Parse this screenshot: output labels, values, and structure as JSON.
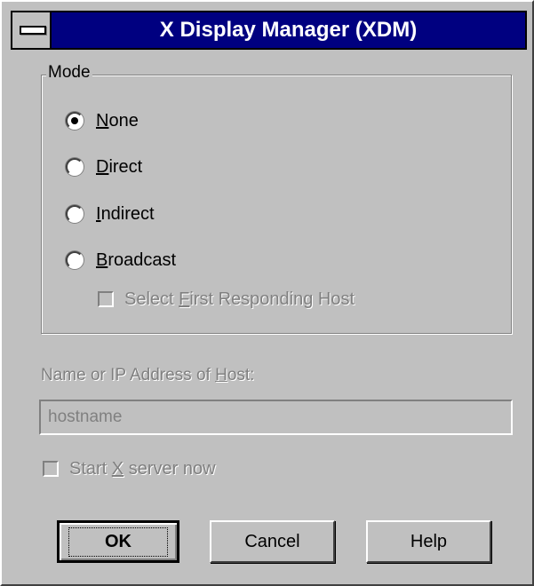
{
  "window": {
    "title": "X Display Manager (XDM)"
  },
  "mode_group": {
    "legend": "Mode",
    "options": [
      {
        "label_pre": "",
        "label_mnemonic": "N",
        "label_post": "one",
        "checked": true
      },
      {
        "label_pre": "",
        "label_mnemonic": "D",
        "label_post": "irect",
        "checked": false
      },
      {
        "label_pre": "",
        "label_mnemonic": "I",
        "label_post": "ndirect",
        "checked": false
      },
      {
        "label_pre": "",
        "label_mnemonic": "B",
        "label_post": "roadcast",
        "checked": false
      }
    ],
    "select_first_host": {
      "label_pre": "Select ",
      "label_mnemonic": "F",
      "label_post": "irst Responding Host",
      "checked": false,
      "enabled": false
    }
  },
  "host": {
    "label_pre": "Name or IP Address of ",
    "label_mnemonic": "H",
    "label_post": "ost:",
    "value": "hostname",
    "enabled": false
  },
  "start_server": {
    "label_pre": "Start ",
    "label_mnemonic": "X",
    "label_post": " server now",
    "checked": false,
    "enabled": false
  },
  "buttons": {
    "ok": "OK",
    "cancel": "Cancel",
    "help": "Help"
  },
  "icons": {
    "system_menu": "system-menu-icon"
  },
  "colors": {
    "titlebar": "#000080",
    "face": "#c0c0c0",
    "disabled_text": "#808080"
  }
}
